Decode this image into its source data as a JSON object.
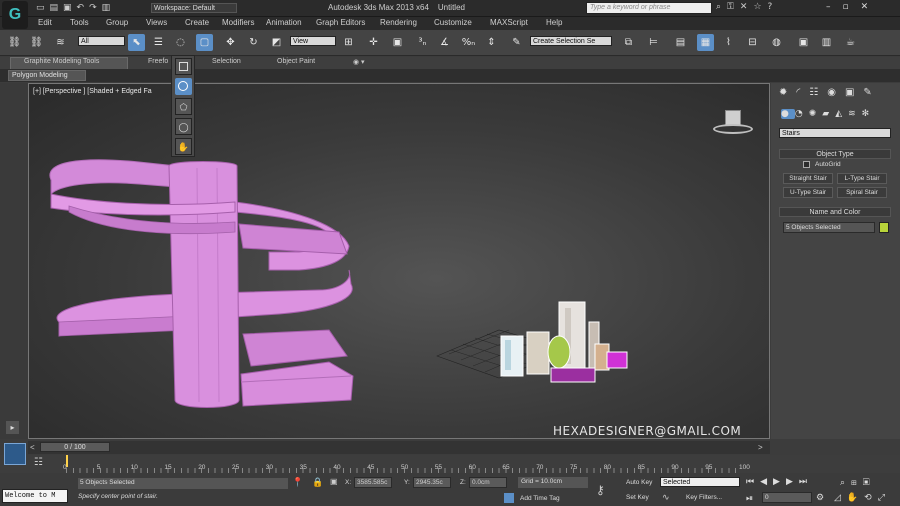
{
  "title": {
    "workspace": "Workspace: Default",
    "app": "Autodesk 3ds Max  2013 x64",
    "file": "Untitled",
    "search_placeholder": "Type a keyword or phrase"
  },
  "menu": [
    "Edit",
    "Tools",
    "Group",
    "Views",
    "Create",
    "Modifiers",
    "Animation",
    "Graph Editors",
    "Rendering",
    "Customize",
    "MAXScript",
    "Help"
  ],
  "toolbar": {
    "filter_value": "All",
    "refcoord_value": "View",
    "named_sel_value": "Create Selection Se"
  },
  "ribbon": {
    "tabs": [
      "Graphite Modeling Tools",
      "Freefo",
      "Selection",
      "Object Paint"
    ],
    "sub_label": "Polygon Modeling"
  },
  "viewport": {
    "label": "[+] [Perspective ] [Shaded + Edged Fa",
    "watermark": "HEXADESIGNER@GMAIL.COM"
  },
  "command_panel": {
    "dropdown": "Stairs",
    "object_type_header": "Object Type",
    "autogrid_label": "AutoGrid",
    "buttons": [
      "Straight Stair",
      "L-Type Stair",
      "U-Type Stair",
      "Spiral Stair"
    ],
    "name_color_header": "Name and Color",
    "name_value": "5 Objects Selected",
    "swatch_color": "#b8d43a"
  },
  "timeline": {
    "frame": "0 / 100"
  },
  "ruler": {
    "ticks": [
      "0",
      "5",
      "10",
      "15",
      "20",
      "25",
      "30",
      "35",
      "40",
      "45",
      "50",
      "55",
      "60",
      "65",
      "70",
      "75",
      "80",
      "85",
      "90",
      "95",
      "100"
    ]
  },
  "status": {
    "maxscript": "Welcome to M",
    "selected": "5 Objects Selected",
    "prompt": "Specify center point of stair.",
    "x_label": "X:",
    "x_value": "3585.585c",
    "y_label": "Y:",
    "y_value": "2945.35c",
    "z_label": "Z:",
    "z_value": "0.0cm",
    "grid": "Grid = 10.0cm",
    "add_time_tag": "Add Time Tag",
    "autokey": "Auto Key",
    "autokey_mode": "Selected",
    "setkey": "Set Key",
    "keyfilters": "Key Filters...",
    "frame_field": "0"
  },
  "colors": {
    "stair": "#d98bdf",
    "accent": "#5b8fc7"
  }
}
